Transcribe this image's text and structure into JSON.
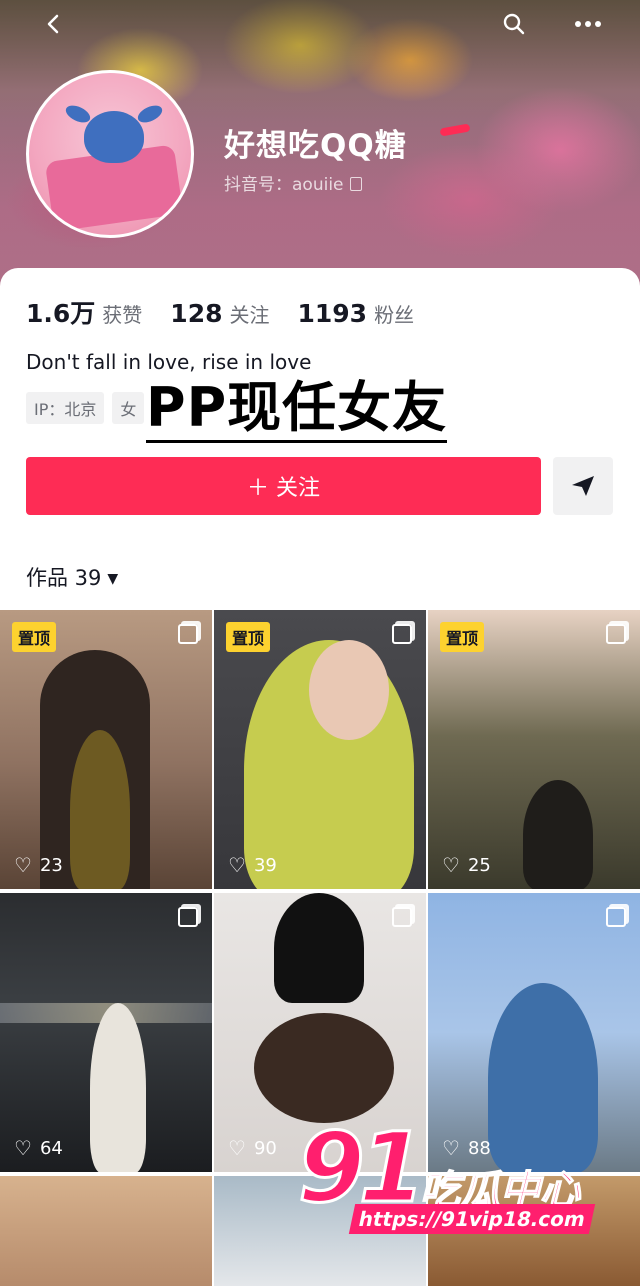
{
  "header": {
    "back_icon": "chevron-left-icon",
    "search_icon": "search-icon",
    "more_icon": "more-dots-icon",
    "nickname": "好想吃QQ糖",
    "douyin_id": "抖音号：aouiie"
  },
  "stats": [
    {
      "value": "1.6万",
      "label": "获赞"
    },
    {
      "value": "128",
      "label": "关注"
    },
    {
      "value": "1193",
      "label": "粉丝"
    }
  ],
  "bio": "Don't fall in love, rise in love",
  "tags": [
    "IP：北京",
    "女"
  ],
  "overlay_caption": "PP现任女友",
  "actions": {
    "follow_label": "＋ 关注",
    "dm_icon": "send-icon"
  },
  "works": {
    "label": "作品 39",
    "caret": "▼"
  },
  "posts": [
    {
      "pinned": "置顶",
      "likes": "23"
    },
    {
      "pinned": "置顶",
      "likes": "39"
    },
    {
      "pinned": "置顶",
      "likes": "25"
    },
    {
      "likes": "64"
    },
    {
      "likes": "90"
    },
    {
      "likes": "88"
    }
  ],
  "watermark": {
    "number": "91",
    "text": "吃瓜中心",
    "url": "https://91vip18.com"
  },
  "colors": {
    "accent": "#fe2c55",
    "pin_badge": "#fdd22f",
    "watermark": "#ff1f6e"
  }
}
